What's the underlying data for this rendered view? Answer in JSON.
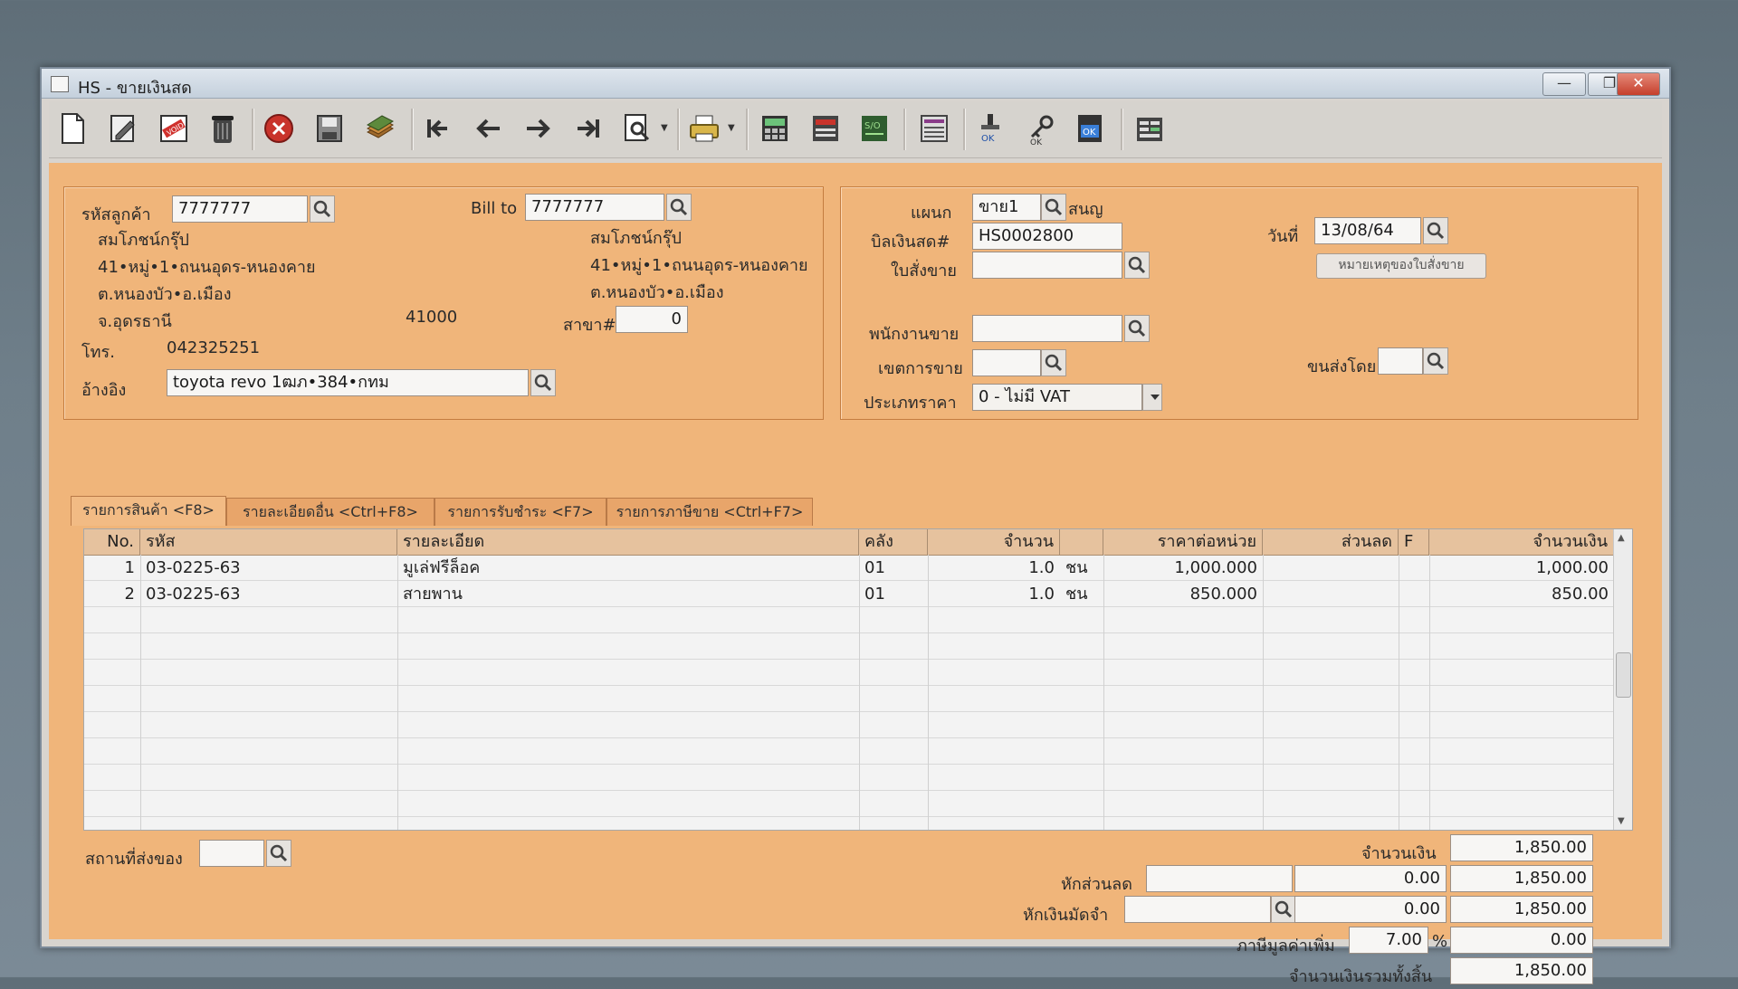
{
  "window": {
    "title": "HS - ขายเงินสด",
    "controls": [
      "—",
      "❐",
      "✕"
    ]
  },
  "toolbar": {
    "icons": [
      "new-document-icon",
      "edit-icon",
      "void-icon",
      "trash-icon",
      "cancel-icon",
      "save-icon",
      "books-icon",
      "first-record-icon",
      "previous-record-icon",
      "next-record-icon",
      "last-record-icon",
      "find-icon",
      "print-icon",
      "calculator-icon",
      "stamp-icon",
      "so-icon",
      "form-icon",
      "approve-icon",
      "key-icon",
      "ok-icon",
      "table-icon"
    ]
  },
  "customer": {
    "code_label": "รหัสลูกค้า",
    "code_value": "7777777",
    "name": "สมโภชน์กรุ๊ป",
    "address1": "41•หมู่•1•ถนนอุดร-หนองคาย",
    "address2": "ต.หนองบัว•อ.เมือง",
    "province": "จ.อุดรธานี",
    "postcode": "41000",
    "phone_label": "โทร.",
    "phone": "042325251",
    "ref_label": "อ้างอิง",
    "ref_value": "toyota revo 1ฒภ•384•กทม"
  },
  "billto": {
    "label": "Bill to",
    "code_value": "7777777",
    "name": "สมโภชน์กรุ๊ป",
    "address1": "41•หมู่•1•ถนนอุดร-หนองคาย",
    "address2": "ต.หนองบัว•อ.เมือง",
    "branch_label": "สาขา#",
    "branch_value": "0"
  },
  "doc": {
    "dept_label": "แผนก",
    "dept_value": "ขาย1",
    "dept_name": "สนญ",
    "bill_label": "บิลเงินสด#",
    "bill_value": "HS0002800",
    "so_label": "ใบสั่งขาย",
    "so_value": "",
    "date_label": "วันที่",
    "date_value": "13/08/64",
    "note_button": "หมายเหตุของใบสั่งขาย",
    "salesman_label": "พนักงานขาย",
    "salesman_value": "",
    "area_label": "เขตการขาย",
    "area_value": "",
    "ship_label": "ขนส่งโดย",
    "ship_value": "",
    "price_type_label": "ประเภทราคา",
    "price_type_value": "0 - ไม่มี VAT"
  },
  "tabs": [
    {
      "label": "รายการสินค้า <F8>"
    },
    {
      "label": "รายละเอียดอื่น <Ctrl+F8>"
    },
    {
      "label": "รายการรับชำระ <F7>"
    },
    {
      "label": "รายการภาษีขาย <Ctrl+F7>"
    }
  ],
  "grid": {
    "headers": [
      "No.",
      "รหัส",
      "รายละเอียด",
      "คลัง",
      "จำนวน",
      "",
      "ราคาต่อหน่วย",
      "ส่วนลด",
      "F",
      "จำนวนเงิน"
    ],
    "rows": [
      {
        "no": "1",
        "code": "03-0225-63",
        "desc": "มูเล่ฟรีล็อค",
        "wh": "01",
        "qty": "1.0",
        "unit": "ชน",
        "price": "1,000.000",
        "disc": "",
        "f": "",
        "amount": "1,000.00"
      },
      {
        "no": "2",
        "code": "03-0225-63",
        "desc": "สายพาน",
        "wh": "01",
        "qty": "1.0",
        "unit": "ชน",
        "price": "850.000",
        "disc": "",
        "f": "",
        "amount": "850.00"
      }
    ]
  },
  "footer": {
    "delivery_label": "สถานที่ส่งของ",
    "delivery_value": "",
    "amount_label": "จำนวนเงิน",
    "amount_value": "1,850.00",
    "discount_label": "หักส่วนลด",
    "discount_text": "",
    "discount_value": "0.00",
    "discount_total": "1,850.00",
    "deposit_label": "หักเงินมัดจำ",
    "deposit_text": "",
    "deposit_value": "0.00",
    "deposit_total": "1,850.00",
    "vat_label": "ภาษีมูลค่าเพิ่ม",
    "vat_rate": "7.00",
    "vat_pct": "%",
    "vat_value": "0.00",
    "grand_label": "จำนวนเงินรวมทั้งสิ้น",
    "grand_value": "1,850.00"
  }
}
